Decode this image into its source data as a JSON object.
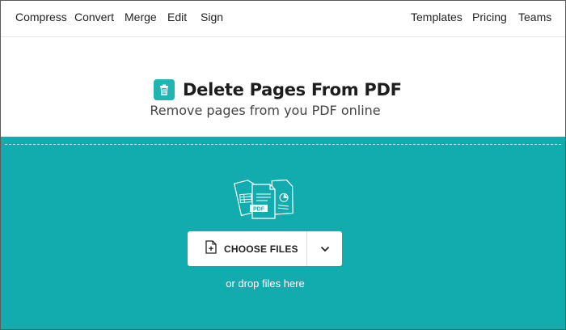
{
  "nav": {
    "left": [
      "Compress",
      "Convert",
      "Merge",
      "Edit",
      "Sign"
    ],
    "right": [
      "Templates",
      "Pricing",
      "Teams"
    ]
  },
  "header": {
    "icon": "trash-icon",
    "title": "Delete Pages From PDF",
    "subtitle": "Remove pages from you PDF online"
  },
  "upload": {
    "illustration": "documents-illustration",
    "illustration_badge": "PDF",
    "choose_files_label": "CHOOSE FILES",
    "choose_files_icon": "file-plus-icon",
    "dropdown_icon": "chevron-down-icon",
    "drop_hint": "or drop files here"
  },
  "colors": {
    "accent": "#12acaf",
    "icon_bg": "#1fb5b2"
  }
}
